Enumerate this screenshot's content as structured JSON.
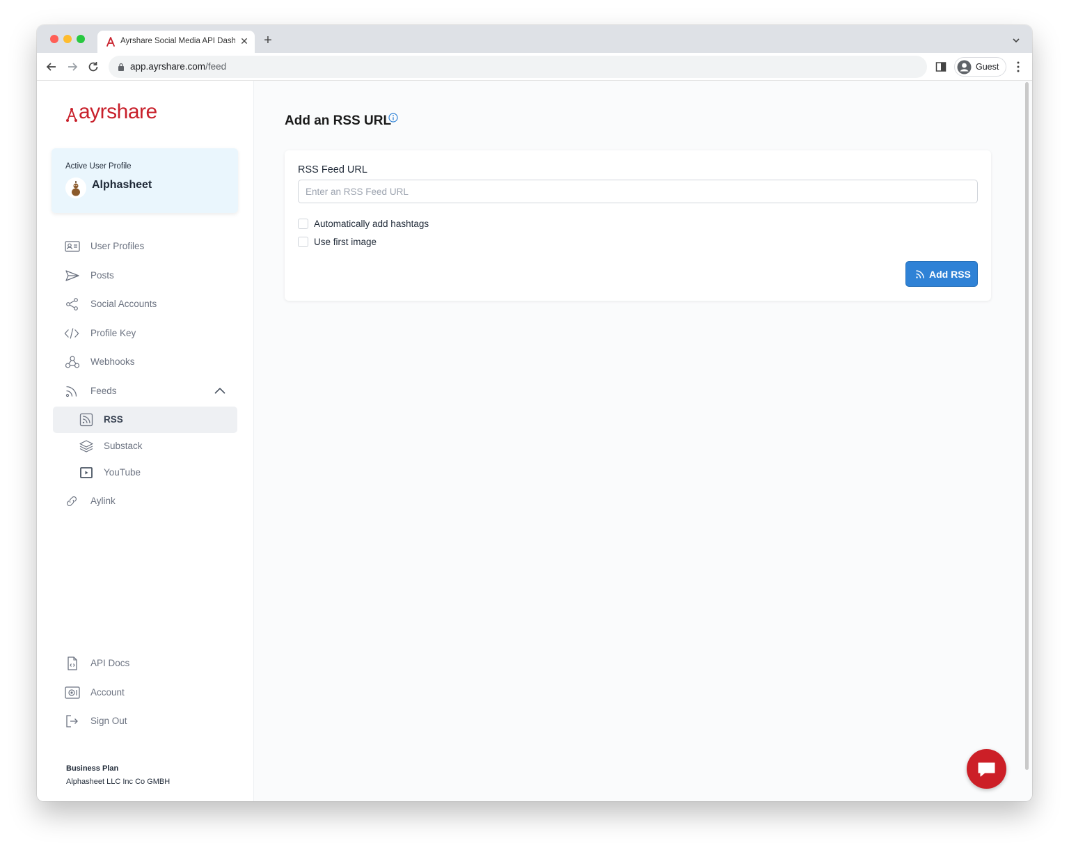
{
  "browser": {
    "tab_title": "Ayrshare Social Media API Dashboard",
    "url_host": "app.ayrshare.com",
    "url_path": "/feed",
    "profile_label": "Guest"
  },
  "sidebar": {
    "logo_text": "ayrshare",
    "profile_caption": "Active User Profile",
    "profile_name": "Alphasheet",
    "nav": [
      {
        "label": "User Profiles",
        "icon": "user-profiles-icon"
      },
      {
        "label": "Posts",
        "icon": "send-icon"
      },
      {
        "label": "Social Accounts",
        "icon": "share-icon"
      },
      {
        "label": "Profile Key",
        "icon": "code-icon"
      },
      {
        "label": "Webhooks",
        "icon": "webhook-icon"
      },
      {
        "label": "Feeds",
        "icon": "rss-icon"
      }
    ],
    "feeds_sub": [
      {
        "label": "RSS",
        "icon": "rss-square-icon"
      },
      {
        "label": "Substack",
        "icon": "layers-icon"
      },
      {
        "label": "YouTube",
        "icon": "youtube-icon"
      }
    ],
    "aylink_label": "Aylink",
    "bottom_nav": [
      {
        "label": "API Docs",
        "icon": "document-icon"
      },
      {
        "label": "Account",
        "icon": "account-icon"
      },
      {
        "label": "Sign Out",
        "icon": "sign-out-icon"
      }
    ],
    "plan_title": "Business Plan",
    "plan_org": "Alphasheet LLC Inc Co GMBH"
  },
  "main": {
    "title": "Add an RSS URL",
    "field_label": "RSS Feed URL",
    "input_placeholder": "Enter an RSS Feed URL",
    "input_value": "",
    "checkbox_hashtags": "Automatically add hashtags",
    "checkbox_first_image": "Use first image",
    "add_button": "Add RSS"
  },
  "colors": {
    "brand_red": "#c8202b",
    "primary_blue": "#2f82d6",
    "profile_card_bg": "#eaf6fd"
  }
}
